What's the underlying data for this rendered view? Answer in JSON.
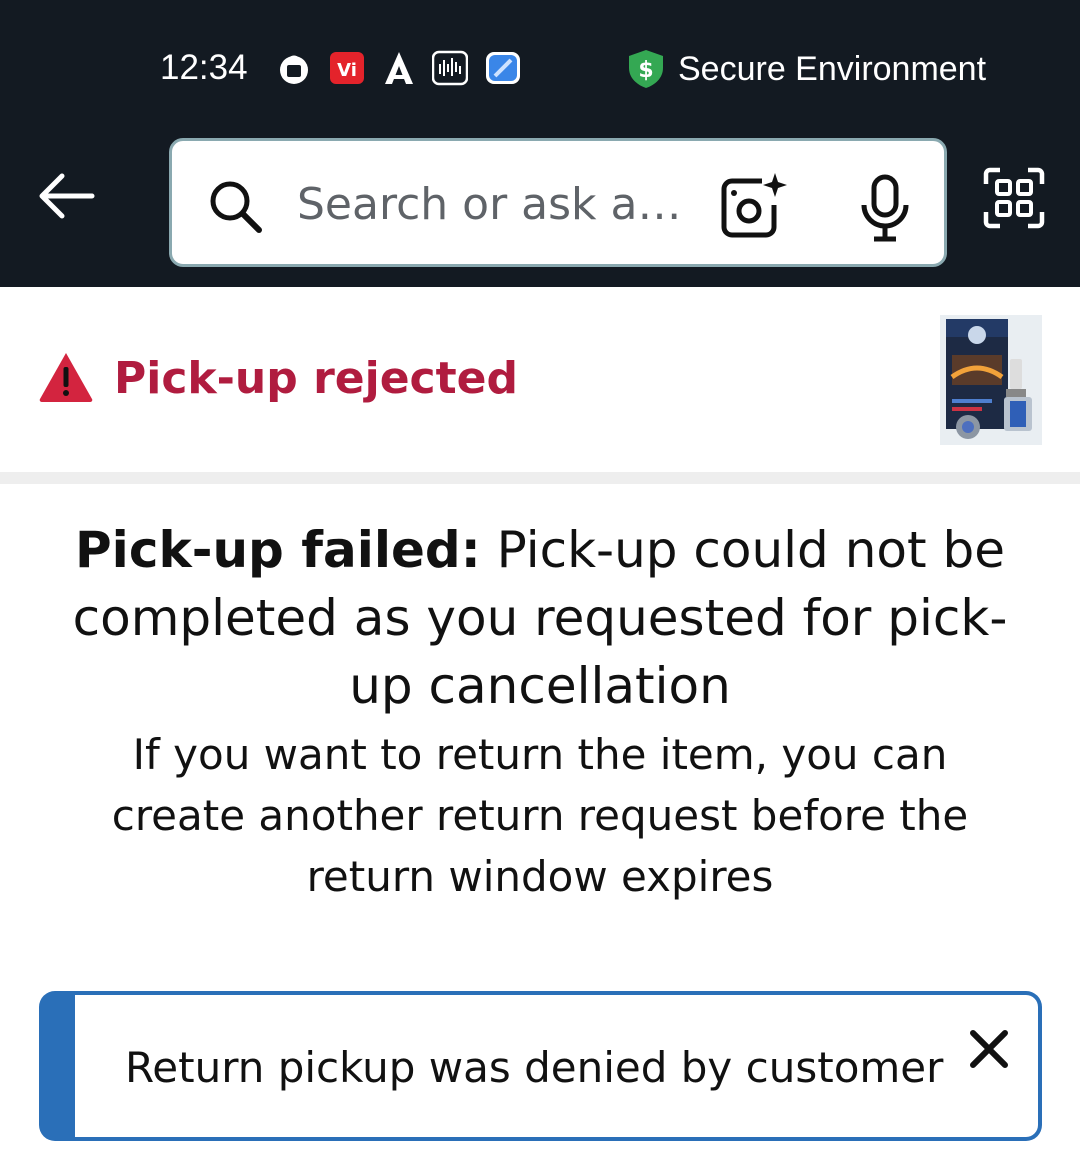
{
  "status_bar": {
    "time": "12:34",
    "secure_label": "Secure Environment",
    "icons": [
      "shopping-bag-icon",
      "vi-app-icon",
      "a-app-icon",
      "audio-levels-icon",
      "blue-app-icon",
      "shield-dollar-icon"
    ]
  },
  "header": {
    "search_placeholder": "Search or ask a…",
    "icons": [
      "back-arrow-icon",
      "search-icon",
      "camera-lens-icon",
      "microphone-icon",
      "qr-scan-icon"
    ],
    "colors": {
      "bar": "#131a22",
      "search_border": "#8aa9b0"
    }
  },
  "status": {
    "title": "Pick-up rejected",
    "icon": "warning-triangle-icon",
    "color": "#b01c3f"
  },
  "message": {
    "bold_prefix": "Pick-up failed:",
    "main_text": "Pick-up could not be completed as you requested for pick-up cancellation",
    "sub_text": "If you want to return the item, you can create another return request before the return window expires"
  },
  "alert": {
    "text": "Return pickup was denied by customer",
    "accent_color": "#2a6fb8",
    "icon": "close-icon"
  }
}
